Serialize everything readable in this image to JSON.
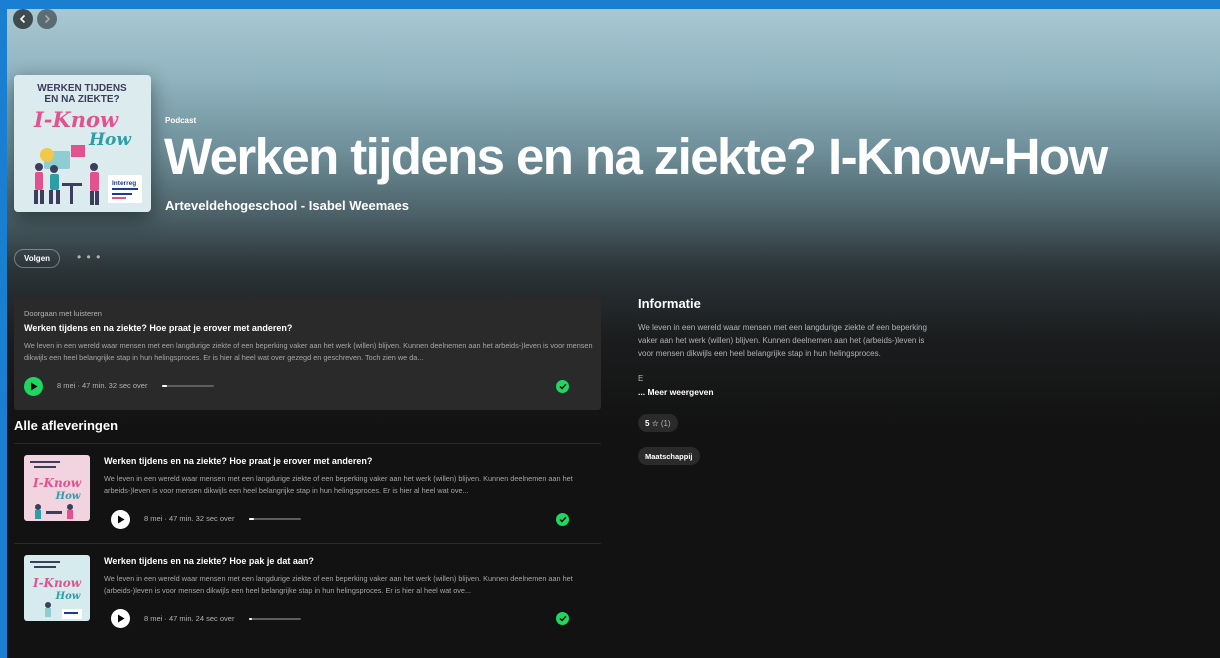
{
  "header": {
    "type_label": "Podcast",
    "title": "Werken tijdens en na ziekte? I-Know-How",
    "author": "Arteveldehogeschool - Isabel Weemaes"
  },
  "cover": {
    "line1": "WERKEN TIJDENS",
    "line2": "EN NA ZIEKTE?",
    "brand": "I-Know",
    "brand2": "How",
    "sponsor": "Interreg"
  },
  "actions": {
    "follow_label": "Volgen",
    "more_label": "• • •"
  },
  "continue_listening": {
    "label": "Doorgaan met luisteren",
    "title": "Werken tijdens en na ziekte? Hoe praat je erover met anderen?",
    "description": "We leven in een wereld waar mensen met een langdurige ziekte of een beperking vaker aan het werk (willen) blijven. Kunnen deelnemen aan het arbeids-)leven is voor mensen dikwijls een heel belangrijke stap in hun helingsproces. Er is hier al heel wat over gezegd en geschreven. Toch zien we da...",
    "meta": "8 mei · 47 min. 32 sec over",
    "progress": 0.1
  },
  "episodes_section": {
    "title": "Alle afleveringen",
    "items": [
      {
        "title": "Werken tijdens en na ziekte? Hoe praat je erover met anderen?",
        "description": "We leven in een wereld waar mensen met een langdurige ziekte of een beperking vaker aan het werk (willen) blijven. Kunnen deelnemen aan het arbeids-)leven is voor mensen dikwijls een heel belangrijke stap in hun helingsproces. Er is hier al heel wat ove...",
        "meta": "8 mei · 47 min. 32 sec over",
        "progress": 0.1
      },
      {
        "title": "Werken tijdens en na ziekte? Hoe pak je dat aan?",
        "description": "We leven in een wereld waar mensen met een langdurige ziekte of een beperking vaker aan het werk (willen) blijven. Kunnen deelnemen aan het (arbeids-)leven is voor mensen dikwijls een heel belangrijke stap in hun helingsproces. Er is hier al heel wat ove...",
        "meta": "8 mei · 47 min. 24 sec over",
        "progress": 0.05
      }
    ]
  },
  "info": {
    "title": "Informatie",
    "text": "We leven in een wereld waar mensen met een langdurige ziekte of een beperking vaker aan het werk (willen) blijven. Kunnen deelnemen aan het (arbeids-)leven is voor mensen dikwijls een heel belangrijke stap in hun helingsproces.",
    "text_tail": "E",
    "more_label": "... Meer weergeven",
    "rating": "5 ☆",
    "rating_count": "(1)",
    "tag": "Maatschappij"
  },
  "colors": {
    "accent_green": "#1ed760",
    "background": "#121212",
    "card": "#2a2a2a",
    "outer_frame": "#1a7fd0"
  },
  "icons": [
    "chevron-left-icon",
    "chevron-right-icon",
    "play-icon",
    "check-icon"
  ]
}
